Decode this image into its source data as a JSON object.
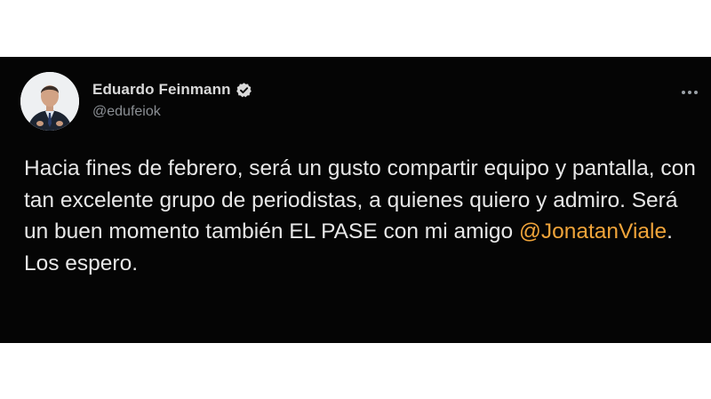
{
  "author": {
    "display_name": "Eduardo Feinmann",
    "handle": "@edufeiok"
  },
  "icons": {
    "verified": "verified-badge-icon",
    "more": "more-horizontal-icon"
  },
  "tweet": {
    "text_before": "Hacia fines de febrero, será un gusto compartir equipo y pantalla, con tan excelente grupo de periodistas, a quienes quiero y admiro. Será un buen momento también EL PASE con  mi amigo ",
    "mention": "@JonatanViale",
    "text_after": ". Los espero."
  },
  "colors": {
    "card_background": "#050505",
    "text": "#e7e7e7",
    "mention": "#f0a43a",
    "handle": "#8b8f94"
  }
}
